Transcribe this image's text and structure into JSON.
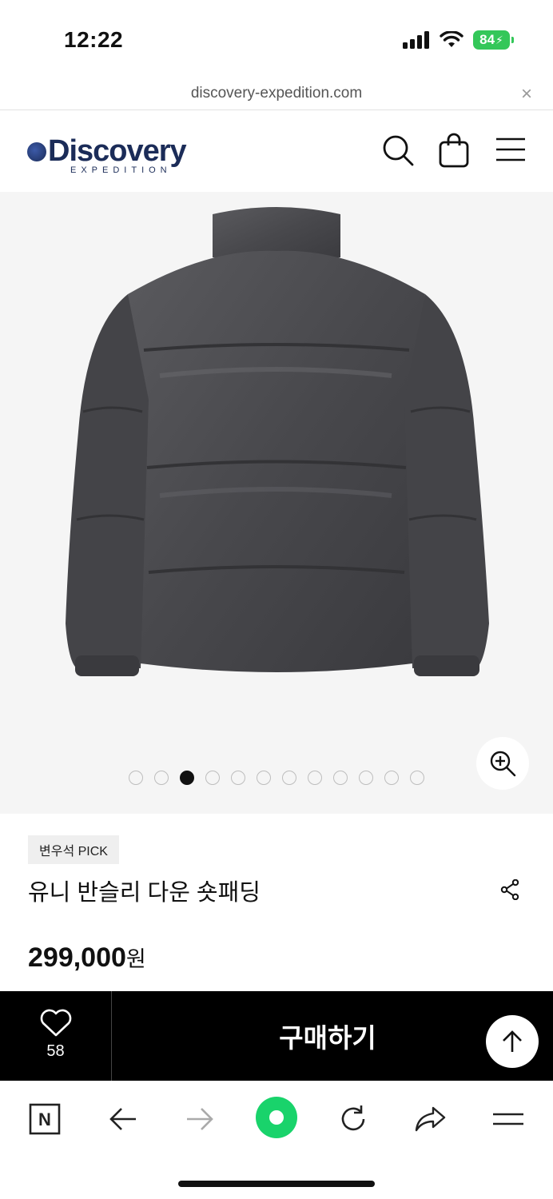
{
  "status_bar": {
    "time": "12:22",
    "battery": "84"
  },
  "browser": {
    "url": "discovery-expedition.com",
    "close_glyph": "×"
  },
  "site_header": {
    "logo_main": "Discovery",
    "logo_sub": "EXPEDITION",
    "icons": [
      "search-icon",
      "shopping-bag-icon",
      "hamburger-menu-icon"
    ]
  },
  "gallery": {
    "total_images": 12,
    "active_index": 3
  },
  "product": {
    "badge": "변우석 PICK",
    "name": "유니 반슬리 다운 숏패딩",
    "price": "299,000",
    "price_unit": "원"
  },
  "buy_bar": {
    "wish_count": "58",
    "buy_label": "구매하기"
  },
  "colors": {
    "brand": "#1b2c58",
    "buy_bar": "#000000",
    "battery": "#34c759",
    "nav_green": "#19d36b"
  },
  "toolbar": {
    "icons": [
      "naver-n-icon",
      "back-arrow-icon",
      "forward-arrow-icon",
      "green-dot-icon",
      "reload-icon",
      "share-icon",
      "menu-icon"
    ]
  }
}
